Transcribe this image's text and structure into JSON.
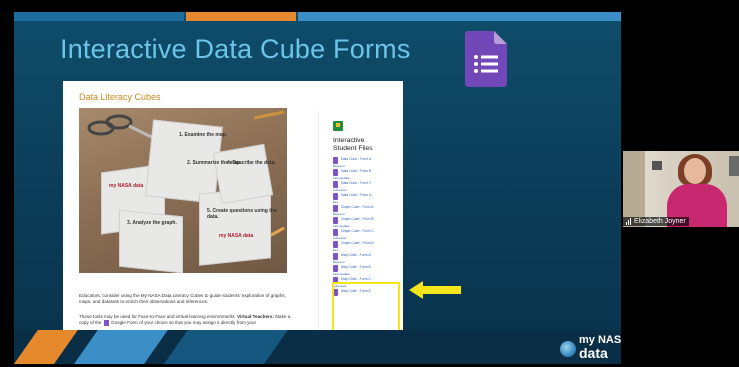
{
  "slide": {
    "title": "Interactive Data Cube Forms",
    "colors": {
      "background": "#0b3c58",
      "title": "#6cc4e8",
      "highlight": "#f2e61b",
      "stripe_orange": "#e5892c",
      "stripe_blue": "#3b8fc6"
    },
    "icon": "google-forms-icon",
    "logo": {
      "line1": "my NASA",
      "line2": "data"
    }
  },
  "webpage": {
    "heading": "Data Literacy Cubes",
    "photo_cube_labels": [
      "1. Examine the map.",
      "2. Summarize the map.",
      "3. Analyze the graph.",
      "4. Describe the data.",
      "5. Create questions using the data.",
      "my NASA data",
      "my NASA data"
    ],
    "paragraph1": "Educators, consider using the My NASA Data Literacy Cubes to guide students' exploration of graphs, maps, and datasets to enrich their observations and inferences.",
    "paragraph2_start": "These tools may be used for Face-to-Face and virtual learning environments.",
    "paragraph2_bold": "Virtual Teachers:",
    "paragraph2_end_a": "Make a copy of the",
    "paragraph2_end_b": "Google Form of your choice so that you may assign it directly from your",
    "sidebar": {
      "title_line1": "Interactive",
      "title_line2": "Student Files",
      "items": [
        {
          "label": "Data Cube - Form A",
          "level": "Beginner"
        },
        {
          "label": "Data Cube - Form B",
          "level": "Intermediate"
        },
        {
          "label": "Data Cube - Form C",
          "level": "Advanced"
        },
        {
          "label": "Data Cube - Form D",
          "level": "ELL"
        },
        {
          "label": "Graph Cube - Form A",
          "level": "Beginner"
        },
        {
          "label": "Graph Cube - Form B",
          "level": "Intermediate"
        },
        {
          "label": "Graph Cube - Form C",
          "level": "Advanced"
        },
        {
          "label": "Graph Cube - Form D",
          "level": "ELL"
        },
        {
          "label": "Map Cube - Form A",
          "level": "Beginner"
        },
        {
          "label": "Map Cube - Form B",
          "level": "Intermediate"
        },
        {
          "label": "Map Cube - Form C",
          "level": "Advanced"
        },
        {
          "label": "Map Cube - Form D",
          "level": ""
        }
      ]
    }
  },
  "participant": {
    "name": "Elizabeth Joyner",
    "icon": "signal-bars-icon"
  }
}
